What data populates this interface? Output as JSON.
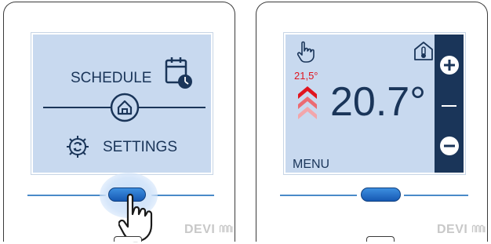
{
  "left_panel": {
    "menu": {
      "schedule_label": "SCHEDULE",
      "settings_label": "SETTINGS"
    },
    "icons": {
      "schedule": "calendar-clock-icon",
      "home": "home-icon",
      "settings": "gear-sync-icon",
      "pointer": "hand-pointer-icon"
    },
    "brand": "DEVI"
  },
  "right_panel": {
    "setpoint": "21,5°",
    "temperature": "20.7°",
    "menu_label": "MENU",
    "icons": {
      "manual": "hand-icon",
      "mode": "house-thermometer-icon",
      "heating": "heating-chevrons-icon",
      "plus": "plus-icon",
      "minus": "minus-icon"
    },
    "brand": "DEVI"
  },
  "colors": {
    "screen_bg": "#c8d9ef",
    "dark_navy": "#1a3559",
    "setpoint_red": "#e0141e",
    "button_blue": "#1f6fd1",
    "brand_grey": "#c8c8c8"
  }
}
